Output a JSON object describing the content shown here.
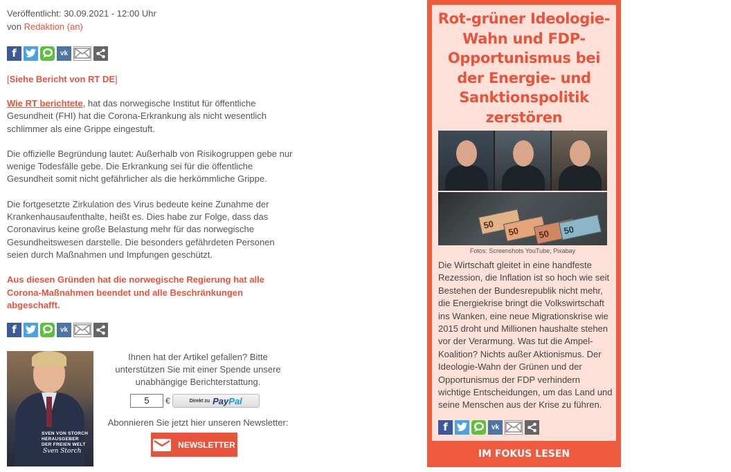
{
  "article": {
    "published": "Veröffentlicht: 30.09.2021 - 12:00 Uhr",
    "by_prefix": "von ",
    "author": "Redaktion (an)",
    "source_open": "[",
    "source_link": "Siehe Bericht von RT DE",
    "source_close": "]",
    "p1_lead": "Wie RT berichtete",
    "p1_rest": ", hat das norwegische Institut für öffentliche Gesundheit (FHI) hat die Corona-Erkrankung als nicht wesentlich schlimmer als eine Grippe eingestuft.",
    "p2": "Die offizielle Begründung lautet: Außerhalb von Risikogruppen gebe nur wenige Todesfälle gebe. Die Erkrankung sei für die öffentliche Gesundheit somit nicht gefährlicher als die herkömmliche Grippe.",
    "p3": "Die fortgesetzte Zirkulation des Virus bedeute keine Zunahme der Krankenhausaufenthalte, heißt es. Dies habe zur Folge, dass das Coronavirus keine große Belastung mehr für das norwegische Gesundheitswesen darstelle. Die besonders gefährdeten Personen seien durch Maßnahmen und Impfungen geschützt.",
    "p4": "Aus diesen Gründen hat die norwegische Regierung hat alle Corona-Maßnahmen beendet und alle Beschränkungen abgeschafft."
  },
  "share_icons": [
    "facebook-icon",
    "twitter-icon",
    "whatsapp-icon",
    "vk-icon",
    "email-icon",
    "share-icon"
  ],
  "share_glyphs": {
    "facebook": "f",
    "vk": "vk"
  },
  "donate": {
    "photo_caption_1": "SVEN VON STORCH",
    "photo_caption_2": "HERAUSGEBER",
    "photo_caption_3": "DER FREIEN WELT",
    "signature": "Sven Storch",
    "text": "Ihnen hat der Artikel gefallen? Bitte unterstützen Sie mit einer Spende unsere unabhängige Berichterstattung.",
    "amount": "5",
    "currency": "€",
    "paypal_small": "Direkt zu",
    "paypal_pay": "Pay",
    "paypal_pal": "Pal",
    "newsletter_label": "Abonnieren Sie jetzt hier unseren Newsletter:",
    "newsletter_button": "NEWSLETTER"
  },
  "focus": {
    "title": "Rot-grüner Ideologie-Wahn und FDP-Opportunismus bei der Energie- und Sanktionspolitik zerstören Deutschland",
    "photo_credit": "Fotos: Screenshots YouTube, Pixabay",
    "banknotes": [
      "50",
      "50",
      "50",
      "50"
    ],
    "description": "Die Wirtschaft gleitet in eine handfeste Rezession, die Inflation ist so hoch wie seit Bestehen der Bundesrepublik nicht mehr, die Energiekrise bringt die Volkswirtschaft ins Wanken, eine neue Migrationskrise wie 2015 droht und Millionen haushalte stehen vor der Verarmung. Was tut die Ampel-Koalition? Nichts außer Aktionismus. Der Ideologie-Wahn der Grünen und der Opportunismus der FDP verhindern wichtige Entscheidungen, um das Land und seine Menschen aus der Krise zu führen.",
    "cta": "IM FOKUS LESEN"
  },
  "colors": {
    "accent": "#e8533b",
    "aside_frame": "#f05a3f",
    "aside_bg": "#fde0d8"
  }
}
